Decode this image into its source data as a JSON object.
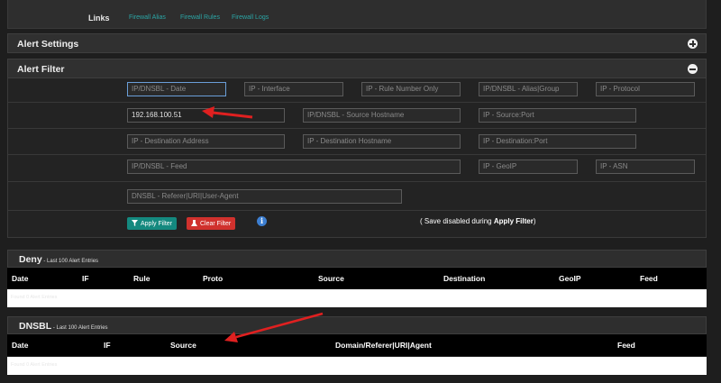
{
  "links": {
    "label": "Links",
    "items": [
      "Firewall Alias",
      "Firewall Rules",
      "Firewall Logs"
    ]
  },
  "alert_settings": {
    "title": "Alert Settings",
    "toggle": "plus-icon"
  },
  "alert_filter": {
    "title": "Alert Filter",
    "toggle": "minus-icon",
    "fields": {
      "date": "IP/DNSBL - Date",
      "interface": "IP - Interface",
      "rule_number": "IP - Rule Number Only",
      "alias_group": "IP/DNSBL - Alias|Group",
      "protocol": "IP - Protocol",
      "source_value": "192.168.100.51",
      "source_hostname": "IP/DNSBL - Source Hostname",
      "source_port": "IP - Source:Port",
      "dest_address": "IP - Destination Address",
      "dest_hostname": "IP - Destination Hostname",
      "dest_port": "IP - Destination:Port",
      "feed": "IP/DNSBL - Feed",
      "geoip": "IP - GeoIP",
      "asn": "IP - ASN",
      "referer": "DNSBL - Referer|URI|User-Agent"
    },
    "apply_label": "Apply Filter",
    "clear_label": "Clear Filter",
    "note_prefix": "( Save disabled during ",
    "note_bold": "Apply Filter",
    "note_suffix": ")"
  },
  "deny": {
    "title": "Deny",
    "subtitle": " - Last 100 Alert Entries",
    "columns": [
      "Date",
      "IF",
      "Rule",
      "Proto",
      "Source",
      "Destination",
      "GeoIP",
      "Feed"
    ],
    "empty_text": "Found 0 Alert Entries"
  },
  "dnsbl": {
    "title": "DNSBL",
    "subtitle": " - Last 100 Alert Entries",
    "columns": [
      "Date",
      "IF",
      "Source",
      "Domain/Referer|URI|Agent",
      "Feed"
    ],
    "empty_text": "Found 0 Alert Entries"
  },
  "colors": {
    "link": "#2ba6a6",
    "apply": "#14897f",
    "clear": "#d0312d",
    "arrow": "#e02020",
    "info": "#3d7fd1"
  }
}
